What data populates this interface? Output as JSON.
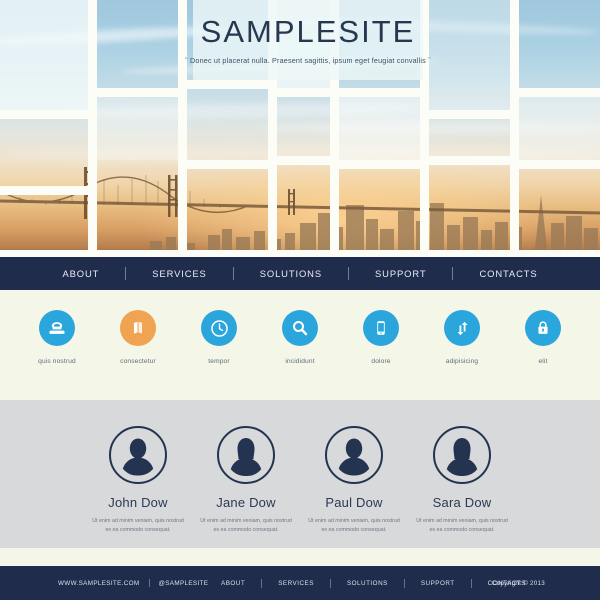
{
  "hero": {
    "title": "SAMPLESITE",
    "quote_open": "“",
    "quote_close": "”",
    "subtitle": "Donec ut placerat nulla. Praesent sagittis, ipsum eget feugiat convallis",
    "image_description": "Bay Bridge and city skyline at sunset, split into a mosaic of tiles"
  },
  "nav": {
    "items": [
      {
        "label": "ABOUT"
      },
      {
        "label": "SERVICES"
      },
      {
        "label": "SOLUTIONS"
      },
      {
        "label": "SUPPORT"
      },
      {
        "label": "CONTACTS"
      }
    ]
  },
  "features": {
    "items": [
      {
        "label": "quis nostrud",
        "icon": "phone-icon",
        "color": "#2ba6dd"
      },
      {
        "label": "consectetur",
        "icon": "book-icon",
        "color": "#f0a350"
      },
      {
        "label": "tempor",
        "icon": "clock-icon",
        "color": "#2ba6dd"
      },
      {
        "label": "incididunt",
        "icon": "search-icon",
        "color": "#2ba6dd"
      },
      {
        "label": "dolore",
        "icon": "mobile-icon",
        "color": "#2ba6dd"
      },
      {
        "label": "adipisicing",
        "icon": "transfer-icon",
        "color": "#2ba6dd"
      },
      {
        "label": "elit",
        "icon": "lock-icon",
        "color": "#2ba6dd"
      }
    ]
  },
  "team": {
    "members": [
      {
        "name": "John Dow",
        "avatar": "avatar-male-icon",
        "desc": "Ut enim ad minim veniam, quis nostrud ex ea commodo consequat."
      },
      {
        "name": "Jane Dow",
        "avatar": "avatar-female-icon",
        "desc": "Ut enim ad minim veniam, quis nostrud ex ea commodo consequat."
      },
      {
        "name": "Paul Dow",
        "avatar": "avatar-male-icon",
        "desc": "Ut enim ad minim veniam, quis nostrud ex ea commodo consequat."
      },
      {
        "name": "Sara Dow",
        "avatar": "avatar-female-icon",
        "desc": "Ut enim ad minim veniam, quis nostrud ex ea commodo consequat."
      }
    ]
  },
  "footer": {
    "site": "WWW.SAMPLESITE.COM",
    "handle": "@SAMPLESITE",
    "nav": [
      {
        "label": "ABOUT"
      },
      {
        "label": "SERVICES"
      },
      {
        "label": "SOLUTIONS"
      },
      {
        "label": "SUPPORT"
      },
      {
        "label": "CONTACTS"
      }
    ],
    "copyright": "Copyright © 2013"
  },
  "colors": {
    "navy": "#1f2c4c",
    "blue": "#2ba6dd",
    "orange": "#f0a350",
    "cream": "#f4f7e8",
    "gray": "#d7d9da",
    "title_text": "#27374f"
  }
}
